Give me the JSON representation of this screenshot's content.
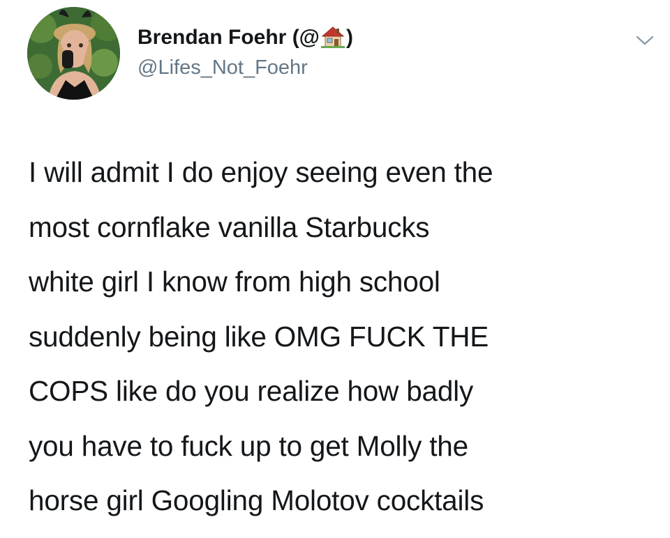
{
  "tweet": {
    "author": {
      "name_prefix": "Brendan Foehr (@",
      "name_suffix": ")",
      "name_emoji": "house-icon",
      "handle": "@Lifes_Not_Foehr",
      "avatar": "avatar"
    },
    "menu_icon": "chevron-down-icon",
    "text": "I will admit I do enjoy seeing even the\nmost cornflake vanilla Starbucks\nwhite girl I know from high school\nsuddenly being like OMG FUCK THE\nCOPS like do you realize how badly\nyou have to fuck up to get Molly the\nhorse girl Googling Molotov cocktails"
  },
  "colors": {
    "text_primary": "#14171a",
    "text_secondary": "#657786",
    "background": "#ffffff"
  }
}
